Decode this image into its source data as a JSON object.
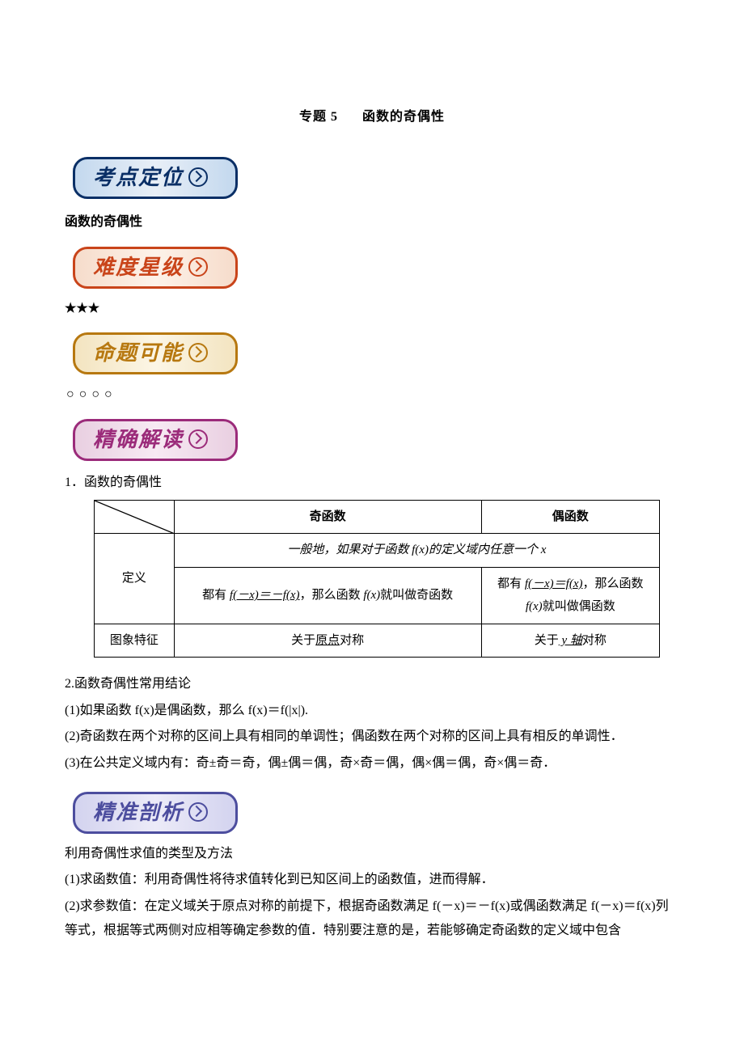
{
  "title": {
    "prefix": "专题 5",
    "main": "函数的奇偶性"
  },
  "badges": {
    "b1": "考点定位",
    "b2": "难度星级",
    "b3": "命题可能",
    "b4": "精确解读",
    "b5": "精准剖析"
  },
  "lines": {
    "l1": "函数的奇偶性",
    "stars": "★★★",
    "circles": "○○○○",
    "sec1": "1．函数的奇偶性"
  },
  "table": {
    "col_odd": "奇函数",
    "col_even": "偶函数",
    "row1_label": "定义",
    "row1_merged": "一般地，如果对于函数 f(x)的定义域内任意一个 x",
    "row2_odd": "都有 f(－x)＝－f(x)，那么函数 f(x)就叫做奇函数",
    "row2_even": "都有 f(－x)＝f(x)，那么函数 f(x)就叫做偶函数",
    "row3_label": "图象特征",
    "row3_odd_pre": "关于",
    "row3_odd_u": "原点",
    "row3_odd_post": "对称",
    "row3_even_pre": "关于",
    "row3_even_u": " y 轴",
    "row3_even_post": "对称",
    "underline_odd_fx": "f(－x)＝－f(x)",
    "underline_even_fx": "f(－x)＝f(x)"
  },
  "sec2": {
    "title": "2.函数奇偶性常用结论",
    "p1": "(1)如果函数 f(x)是偶函数，那么 f(x)＝f(|x|).",
    "p2": "(2)奇函数在两个对称的区间上具有相同的单调性；偶函数在两个对称的区间上具有相反的单调性．",
    "p3": "(3)在公共定义域内有：奇±奇＝奇，偶±偶＝偶，奇×奇＝偶，偶×偶＝偶，奇×偶＝奇．"
  },
  "sec3": {
    "lead": "利用奇偶性求值的类型及方法",
    "p1": "(1)求函数值：利用奇偶性将待求值转化到已知区间上的函数值，进而得解．",
    "p2": "(2)求参数值：在定义域关于原点对称的前提下，根据奇函数满足 f(－x)＝－f(x)或偶函数满足 f(－x)＝f(x)列等式，根据等式两侧对应相等确定参数的值．特别要注意的是，若能够确定奇函数的定义域中包含"
  }
}
